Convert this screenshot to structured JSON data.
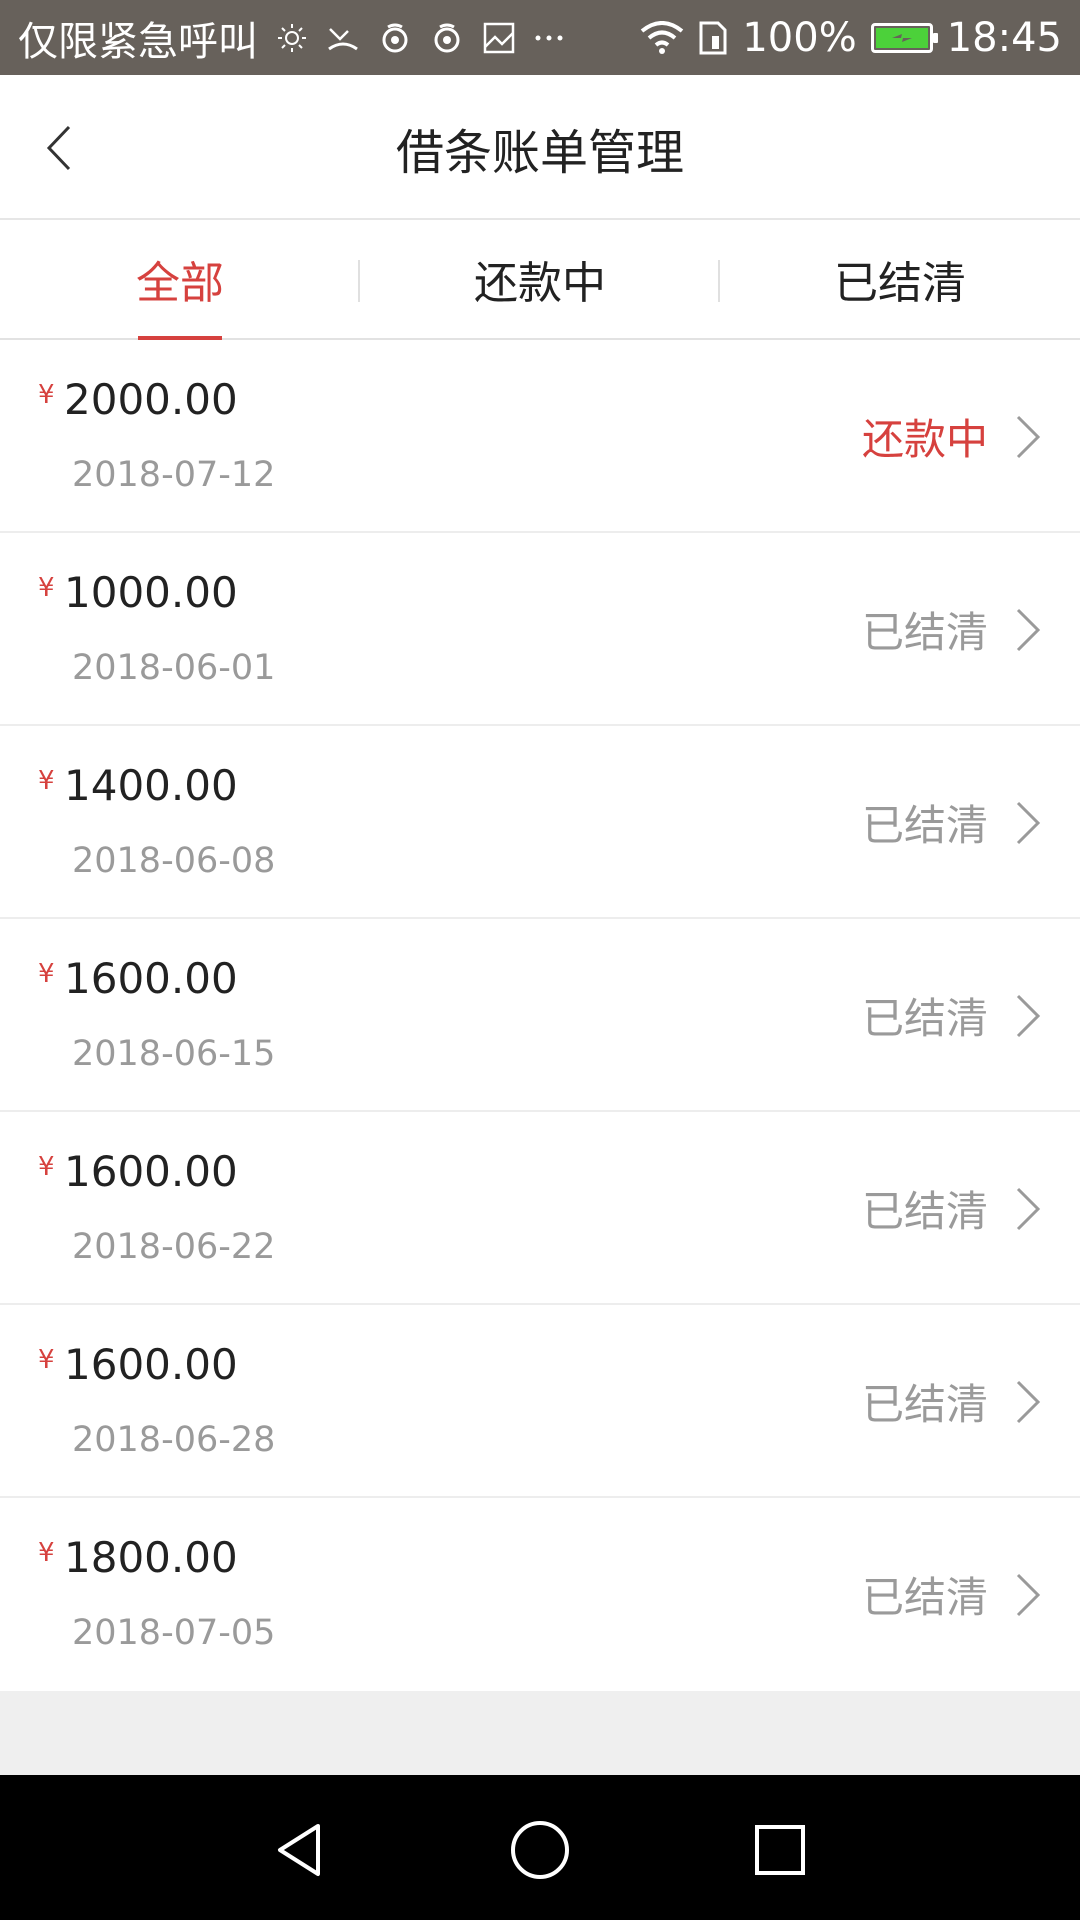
{
  "status_bar": {
    "carrier": "仅限紧急呼叫",
    "battery_percent": "100%",
    "time": "18:45",
    "icons": [
      "brightness-icon",
      "missed-call-icon",
      "app-notification-icon",
      "app-notification-icon",
      "image-icon",
      "more-icon",
      "wifi-icon",
      "sim-icon",
      "battery-charging-icon"
    ]
  },
  "header": {
    "back_icon": "chevron-left-icon",
    "title": "借条账单管理"
  },
  "tabs": [
    {
      "label": "全部",
      "active": true
    },
    {
      "label": "还款中",
      "active": false
    },
    {
      "label": "已结清",
      "active": false
    }
  ],
  "currency_symbol": "¥",
  "bills": [
    {
      "amount": "2000.00",
      "date": "2018-07-12",
      "status": "还款中",
      "state": "ongoing"
    },
    {
      "amount": "1000.00",
      "date": "2018-06-01",
      "status": "已结清",
      "state": "settled"
    },
    {
      "amount": "1400.00",
      "date": "2018-06-08",
      "status": "已结清",
      "state": "settled"
    },
    {
      "amount": "1600.00",
      "date": "2018-06-15",
      "status": "已结清",
      "state": "settled"
    },
    {
      "amount": "1600.00",
      "date": "2018-06-22",
      "status": "已结清",
      "state": "settled"
    },
    {
      "amount": "1600.00",
      "date": "2018-06-28",
      "status": "已结清",
      "state": "settled"
    },
    {
      "amount": "1800.00",
      "date": "2018-07-05",
      "status": "已结清",
      "state": "settled"
    }
  ],
  "colors": {
    "accent": "#d6413e",
    "status_bar": "#67615b",
    "muted_text": "#9a9a9a",
    "background": "#efefef"
  },
  "nav_bar": [
    "back-triangle-icon",
    "home-circle-icon",
    "recents-square-icon"
  ]
}
